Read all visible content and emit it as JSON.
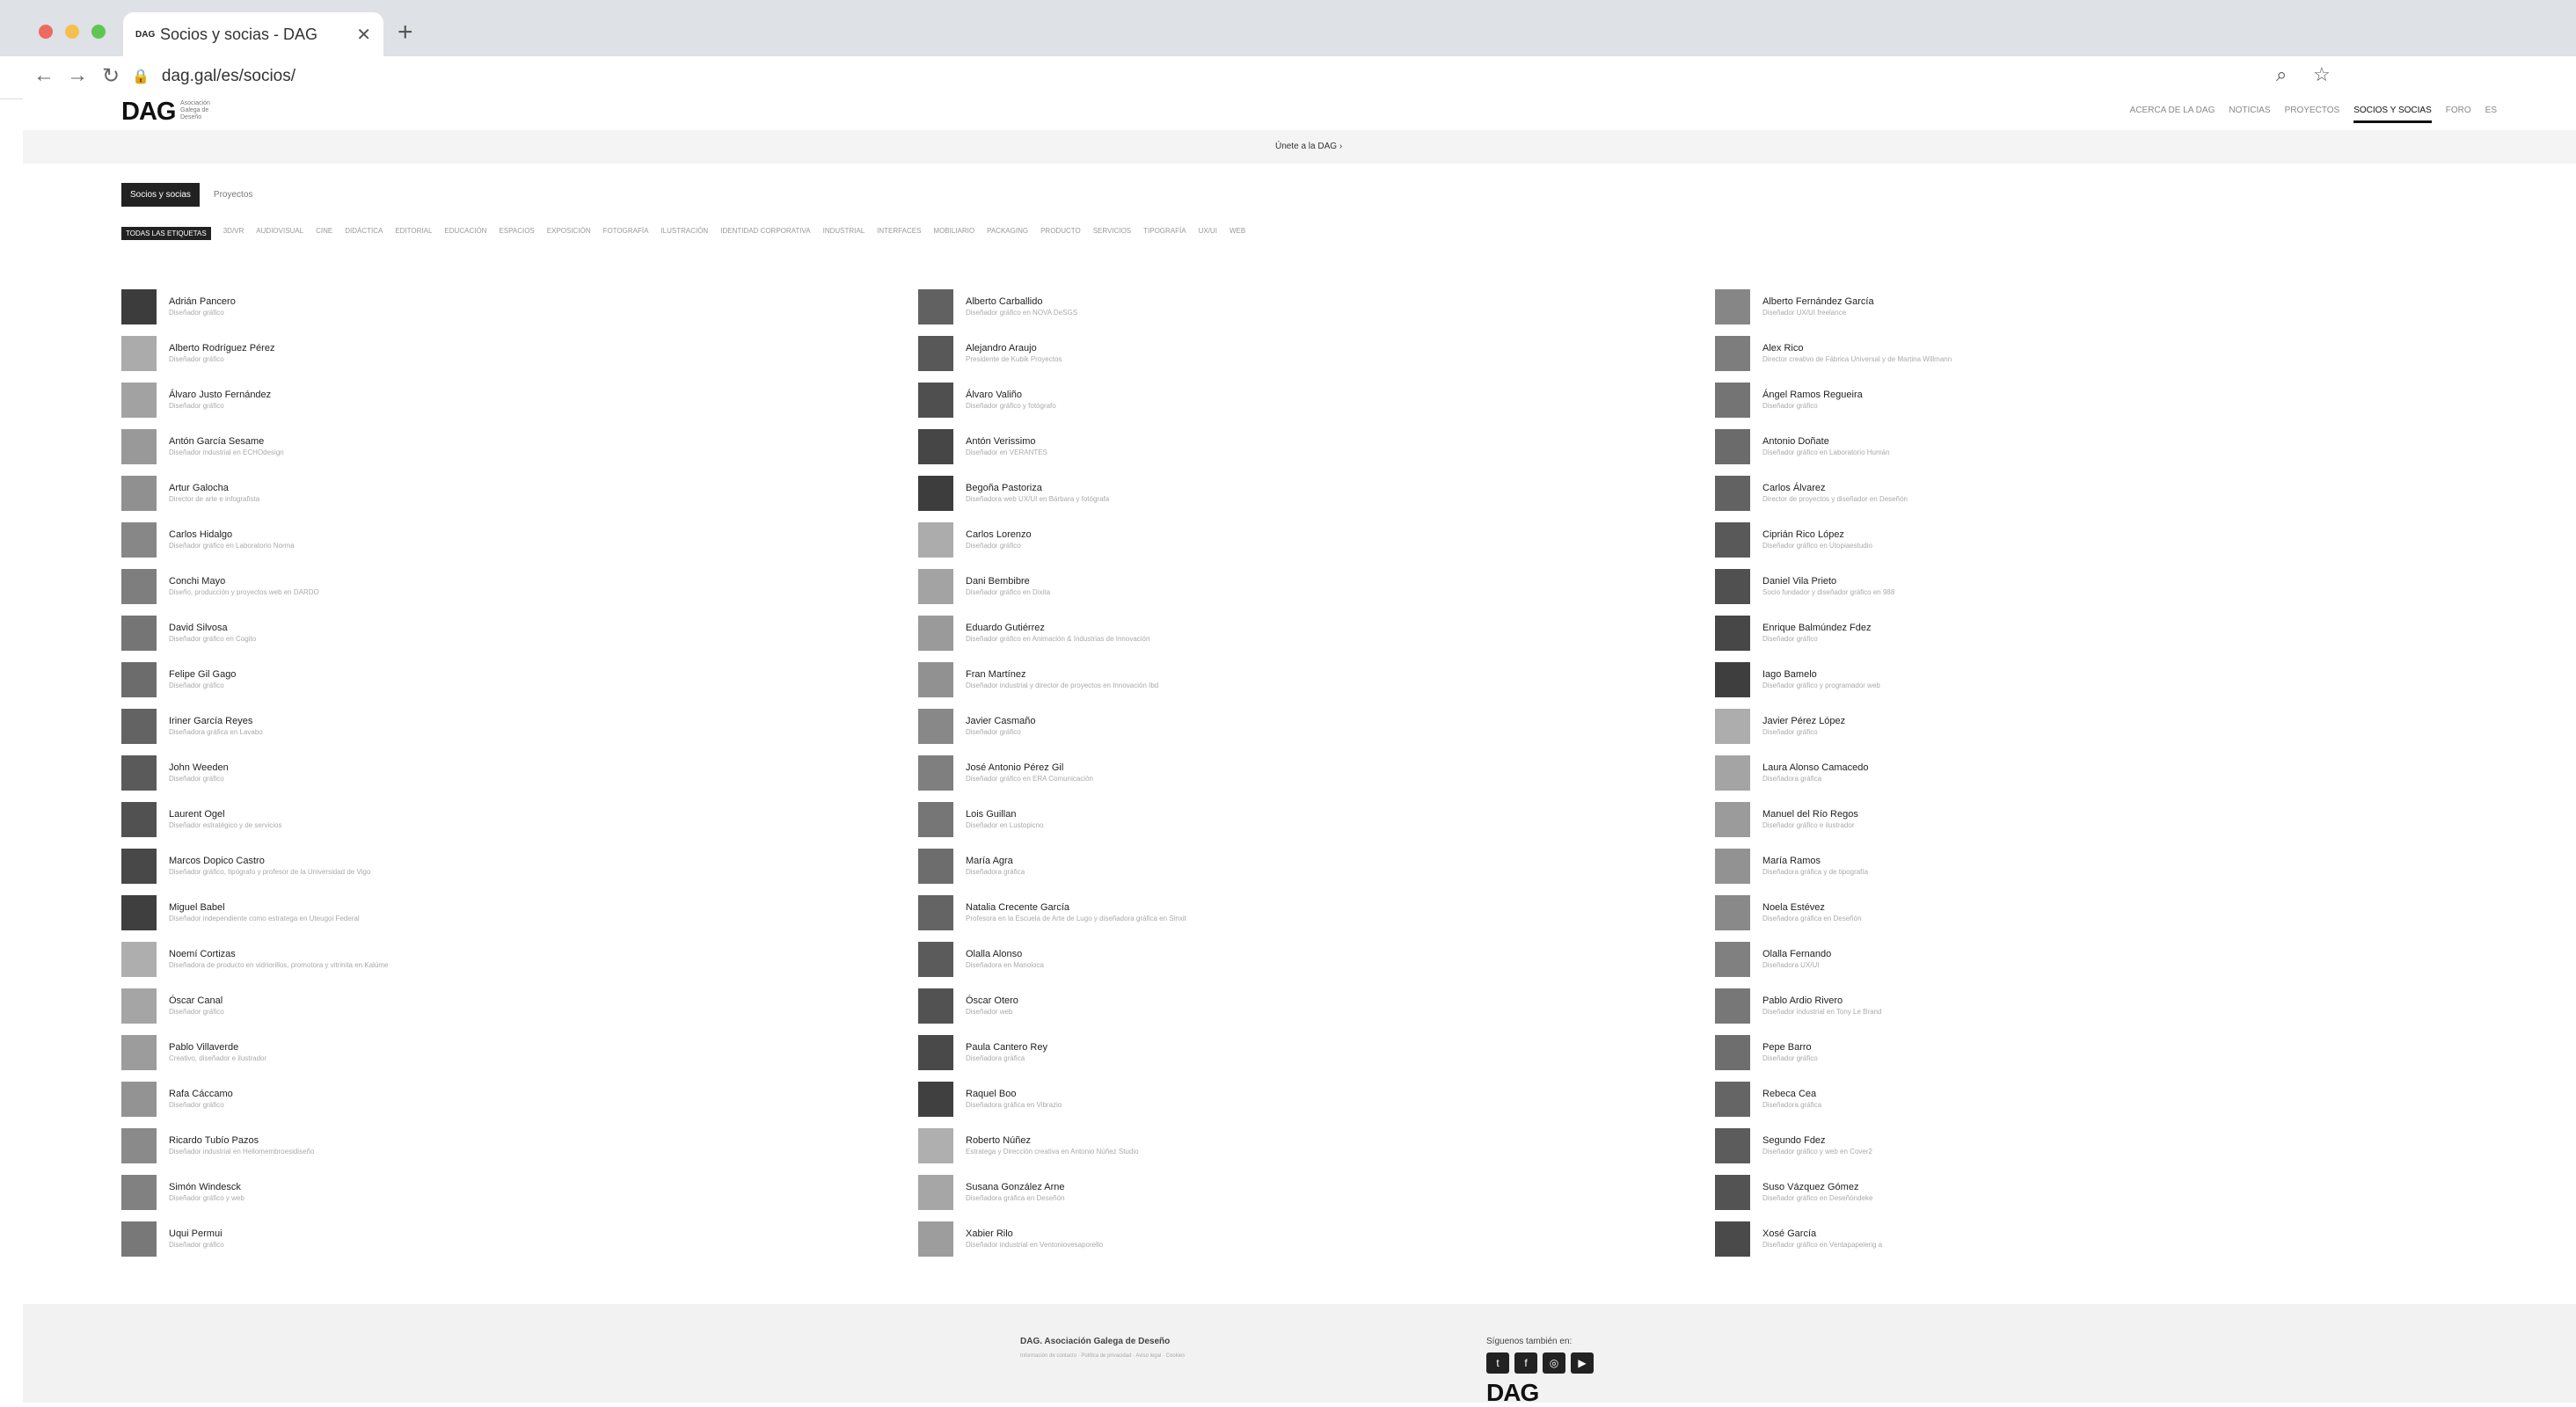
{
  "browser": {
    "tab_title": "Socios y socias - DAG",
    "tab_favicon": "DAG",
    "url": "dag.gal/es/socios/",
    "traffic_colors": [
      "#ec6a5e",
      "#f4bf4f",
      "#61c554"
    ]
  },
  "site": {
    "logo": "DAG",
    "logo_sub": "Asociación Galega de Deseño",
    "nav": [
      "ACERCA DE LA DAG",
      "NOTICIAS",
      "PROYECTOS",
      "SOCIOS Y SOCIAS",
      "FORO",
      "ES"
    ],
    "active_nav": "SOCIOS Y SOCIAS",
    "hero_link": "Únete a la DAG ›"
  },
  "filters": {
    "tabs": [
      "Socios y socias",
      "Proyectos"
    ],
    "active_tab": "Socios y socias",
    "tags": [
      "TODAS LAS ETIQUETAS",
      "3D/VR",
      "AUDIOVISUAL",
      "CINE",
      "DIDÁCTICA",
      "EDITORIAL",
      "EDUCACIÓN",
      "ESPACIOS",
      "EXPOSICIÓN",
      "FOTOGRAFÍA",
      "ILUSTRACIÓN",
      "IDENTIDAD CORPORATIVA",
      "INDUSTRIAL",
      "INTERFACES",
      "MOBILIARIO",
      "PACKAGING",
      "PRODUCTO",
      "SERVICIOS",
      "TIPOGRAFÍA",
      "UX/UI",
      "WEB"
    ]
  },
  "members": [
    {
      "name": "Adrián Pancero",
      "role": "Diseñador gráfico"
    },
    {
      "name": "Alberto Carballido",
      "role": "Diseñador gráfico en NOVA DeSGS"
    },
    {
      "name": "Alberto Fernández García",
      "role": "Diseñador UX/UI freelance"
    },
    {
      "name": "Alberto Rodríguez Pérez",
      "role": "Diseñador gráfico"
    },
    {
      "name": "Alejandro Araujo",
      "role": "Presidente de Kubik Proyectos"
    },
    {
      "name": "Alex Rico",
      "role": "Director creativo de Fábrica Universal y de Martina Willmann"
    },
    {
      "name": "Álvaro Justo Fernández",
      "role": "Diseñador gráfico"
    },
    {
      "name": "Álvaro Valiño",
      "role": "Diseñador gráfico y fotógrafo"
    },
    {
      "name": "Ángel Ramos Regueira",
      "role": "Diseñador gráfico"
    },
    {
      "name": "Antón García Sesame",
      "role": "Diseñador industrial en ECHOdesign"
    },
    {
      "name": "Antón Verissimo",
      "role": "Diseñador en VERANTES"
    },
    {
      "name": "Antonio Doñate",
      "role": "Diseñador gráfico en Laboratorio Humán"
    },
    {
      "name": "Artur Galocha",
      "role": "Director de arte e infografista"
    },
    {
      "name": "Begoña Pastoriza",
      "role": "Diseñadora web UX/UI en Bárbara y fotógrafa"
    },
    {
      "name": "Carlos Álvarez",
      "role": "Director de proyectos y diseñador en Deseñón"
    },
    {
      "name": "Carlos Hidalgo",
      "role": "Diseñador gráfico en Laboratorio Norma"
    },
    {
      "name": "Carlos Lorenzo",
      "role": "Diseñador gráfico"
    },
    {
      "name": "Ciprián Rico López",
      "role": "Diseñador gráfico en Utopiaestudio"
    },
    {
      "name": "Conchi Mayo",
      "role": "Diseño, producción y proyectos web en DARDO"
    },
    {
      "name": "Dani Bembibre",
      "role": "Diseñador gráfico en Dixita"
    },
    {
      "name": "Daniel Vila Prieto",
      "role": "Socio fundador y diseñador gráfico en 988"
    },
    {
      "name": "David Silvosa",
      "role": "Diseñador gráfico en Cogito"
    },
    {
      "name": "Eduardo Gutiérrez",
      "role": "Diseñador gráfico en Animación & Industrias de Innovación"
    },
    {
      "name": "Enrique Balmúndez Fdez",
      "role": "Diseñador gráfico"
    },
    {
      "name": "Felipe Gil Gago",
      "role": "Diseñador gráfico"
    },
    {
      "name": "Fran Martínez",
      "role": "Diseñador industrial y director de proyectos en Innovación Ibd"
    },
    {
      "name": "Iago Bamelo",
      "role": "Diseñador gráfico y programador web"
    },
    {
      "name": "Iriner García Reyes",
      "role": "Diseñadora gráfica en Lavabo"
    },
    {
      "name": "Javier Casmaño",
      "role": "Diseñador gráfico"
    },
    {
      "name": "Javier Pérez López",
      "role": "Diseñador gráfico"
    },
    {
      "name": "John Weeden",
      "role": "Diseñador gráfico"
    },
    {
      "name": "José Antonio Pérez Gil",
      "role": "Diseñador gráfico en ERA Comunicación"
    },
    {
      "name": "Laura Alonso Camacedo",
      "role": "Diseñadora gráfica"
    },
    {
      "name": "Laurent Ogel",
      "role": "Diseñador estratégico y de servicios"
    },
    {
      "name": "Lois Guillan",
      "role": "Diseñador en Lustopicno"
    },
    {
      "name": "Manuel del Río Regos",
      "role": "Diseñador gráfico e ilustrador"
    },
    {
      "name": "Marcos Dopico Castro",
      "role": "Diseñador gráfico, tipógrafo y profesor de la Universidad de Vigo"
    },
    {
      "name": "María Agra",
      "role": "Diseñadora gráfica"
    },
    {
      "name": "María Ramos",
      "role": "Diseñadora gráfica y de tipografía"
    },
    {
      "name": "Miguel Babel",
      "role": "Diseñador independiente como estratega en Uteugoi Federal"
    },
    {
      "name": "Natalia Crecente García",
      "role": "Profesora en la Escuela de Arte de Lugo y diseñadora gráfica en Sinxit"
    },
    {
      "name": "Noela Estévez",
      "role": "Diseñadora gráfica en Deseñón"
    },
    {
      "name": "Noemí Cortizas",
      "role": "Diseñadora de producto en vidriorillos, promotora y vitrinita en Kalúme"
    },
    {
      "name": "Olalla Alonso",
      "role": "Diseñadora en Manoloca"
    },
    {
      "name": "Olalla Fernando",
      "role": "Diseñadora UX/UI"
    },
    {
      "name": "Óscar Canal",
      "role": "Diseñador gráfico"
    },
    {
      "name": "Óscar Otero",
      "role": "Diseñador web"
    },
    {
      "name": "Pablo Ardio Rivero",
      "role": "Diseñador industrial en Tony Le Brand"
    },
    {
      "name": "Pablo Villaverde",
      "role": "Creativo, diseñador e ilustrador"
    },
    {
      "name": "Paula Cantero Rey",
      "role": "Diseñadora gráfica"
    },
    {
      "name": "Pepe Barro",
      "role": "Diseñador gráfico"
    },
    {
      "name": "Rafa Cáccamo",
      "role": "Diseñador gráfico"
    },
    {
      "name": "Raquel Boo",
      "role": "Diseñadora gráfica en Vibrazio"
    },
    {
      "name": "Rebeca Cea",
      "role": "Diseñadora gráfica"
    },
    {
      "name": "Ricardo Tubío Pazos",
      "role": "Diseñador industrial en Hellomembroesidiseño"
    },
    {
      "name": "Roberto Núñez",
      "role": "Estratega y Dirección creativa en Antonio Núñez Studio"
    },
    {
      "name": "Segundo Fdez",
      "role": "Diseñador gráfico y web en Cover2"
    },
    {
      "name": "Simón Windesck",
      "role": "Diseñador gráfico y web"
    },
    {
      "name": "Susana González Arne",
      "role": "Diseñadora gráfica en Deseñón"
    },
    {
      "name": "Suso Vázquez Gómez",
      "role": "Diseñador gráfico en Deseñóndeke"
    },
    {
      "name": "Uqui Permui",
      "role": "Diseñador gráfico"
    },
    {
      "name": "Xabier Rilo",
      "role": "Diseñador industrial en Ventoniovesaporello"
    },
    {
      "name": "Xosé García",
      "role": "Diseñador gráfico en Ventapapelerig a"
    }
  ],
  "footer": {
    "org": "DAG. Asociación Galega de Deseño",
    "lines": "Información de contacto · Política de privacidad · Aviso legal · Cookies",
    "follow": "Síguenos también en:",
    "social": [
      "twitter-icon",
      "facebook-icon",
      "instagram-icon",
      "youtube-icon"
    ],
    "logo": "DAG"
  }
}
